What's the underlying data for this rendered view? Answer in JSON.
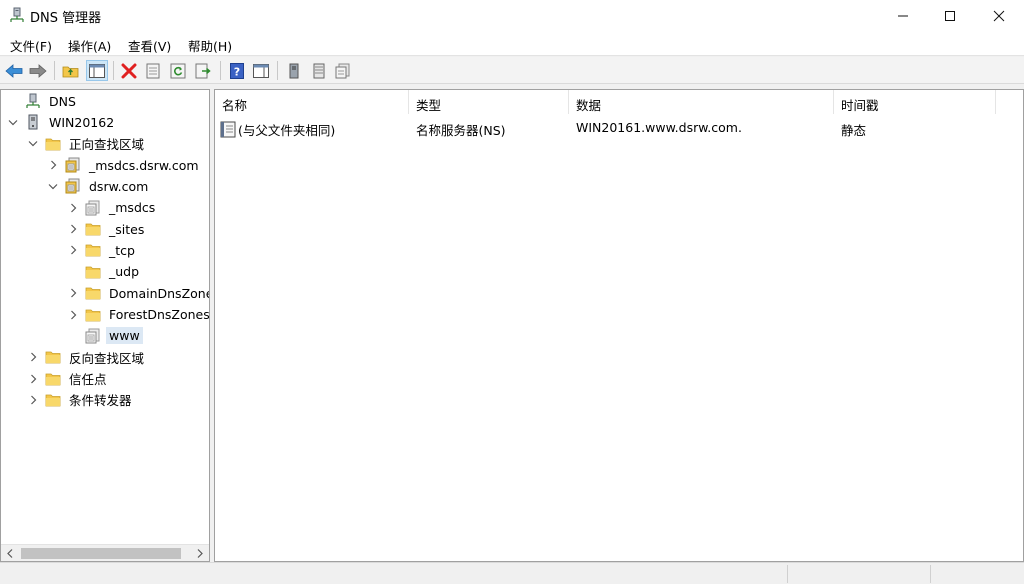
{
  "window": {
    "title": "DNS 管理器"
  },
  "menu": [
    "文件(F)",
    "操作(A)",
    "查看(V)",
    "帮助(H)"
  ],
  "tree": [
    {
      "label": "DNS",
      "level": 0,
      "expander": "none",
      "icon": "dns-server-icon"
    },
    {
      "label": "WIN20162",
      "level": 0,
      "expander": "expanded",
      "icon": "server-icon"
    },
    {
      "label": "正向查找区域",
      "level": 1,
      "expander": "expanded",
      "icon": "folder-icon"
    },
    {
      "label": "_msdcs.dsrw.com",
      "level": 2,
      "expander": "collapsed",
      "icon": "zone-icon"
    },
    {
      "label": "dsrw.com",
      "level": 2,
      "expander": "expanded",
      "icon": "zone-icon"
    },
    {
      "label": "_msdcs",
      "level": 3,
      "expander": "collapsed",
      "icon": "delegated-zone-icon"
    },
    {
      "label": "_sites",
      "level": 3,
      "expander": "collapsed",
      "icon": "folder-icon"
    },
    {
      "label": "_tcp",
      "level": 3,
      "expander": "collapsed",
      "icon": "folder-icon"
    },
    {
      "label": "_udp",
      "level": 3,
      "expander": "none",
      "icon": "folder-icon"
    },
    {
      "label": "DomainDnsZones",
      "level": 3,
      "expander": "collapsed",
      "icon": "folder-icon"
    },
    {
      "label": "ForestDnsZones",
      "level": 3,
      "expander": "collapsed",
      "icon": "folder-icon"
    },
    {
      "label": "www",
      "level": 3,
      "expander": "none",
      "icon": "delegated-zone-icon",
      "selected": true
    },
    {
      "label": "反向查找区域",
      "level": 1,
      "expander": "collapsed",
      "icon": "folder-icon"
    },
    {
      "label": "信任点",
      "level": 1,
      "expander": "collapsed",
      "icon": "folder-icon"
    },
    {
      "label": "条件转发器",
      "level": 1,
      "expander": "collapsed",
      "icon": "folder-icon"
    }
  ],
  "list": {
    "columns": [
      "名称",
      "类型",
      "数据",
      "时间戳"
    ],
    "rows": [
      {
        "name": "(与父文件夹相同)",
        "type": "名称服务器(NS)",
        "data": "WIN20161.www.dsrw.com.",
        "timestamp": "静态"
      }
    ]
  },
  "colors": {
    "accent": "#0078d7",
    "selection": "#dce8f4",
    "folder": "#f3c649",
    "delete": "#e02020"
  }
}
